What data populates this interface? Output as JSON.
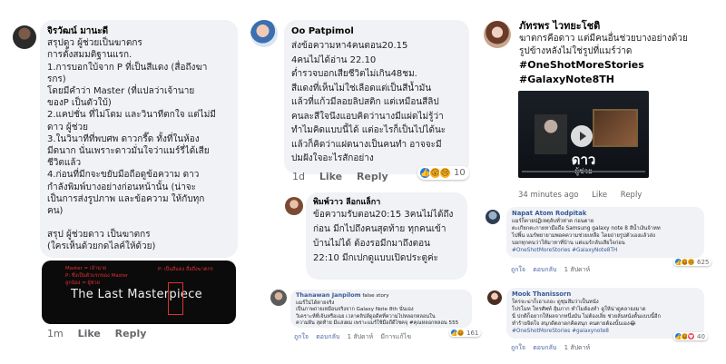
{
  "c1": {
    "name": "จิรวัฒน์ มานะดี",
    "lines": [
      "สรุปดูว ผู้ช่วยเป็นฆาตกร",
      "การตั้งสมมติฐานแรก.",
      "1.การบอกใบ้จาก P ที่เป็นสีแดง (สื่อถึงฆา",
      "รกร)",
      "โดยมีคำว่า Master (ที่แปลว่าเจ้านาย",
      "ของP เป็นตัวใบ้)",
      "2.แคปชั่น ที่ไม่โดม และวินาทีตกใจ แต่ไม่มี",
      "ดาว ผู้ช่วย",
      "3.ในวินาทีที่พบศพ ดาวกรี๊ด ทั้งที่ในห้อง",
      "มีดนาก นั่นเพราะดาวมั่นใจว่าแมร์รี่ได้เสีย",
      "ชีวิตแล้ว",
      "4.ก่อนที่มีกจะขยับมือถือดูข้อความ ดาว",
      "กำลังพิมพ์บางอย่างก่อนหน้านั้น (น่าจะ",
      "เป็นการส่งรูปภาพ และข้อความ ให้กับทุก",
      "คน)",
      "",
      "สรุป ผู้ช่วยดาว เป็นฆาตกร",
      "(ใครเห็นด้วยกดไลค์ให้ด้วย)"
    ],
    "img_small": [
      "Master = เจ้านาย",
      "P: ซึ่งเป็นตัวแรกของ Master",
      "ลูกน้อง = ผู้ช่วย"
    ],
    "img_right": "P: เป็นสีแดง สื่อถึงฆาตกร",
    "img_title_a": "The Last ",
    "img_title_b": "Masterp",
    "img_title_c": "iece",
    "meta": [
      "1m",
      "Like",
      "Reply"
    ]
  },
  "c2": {
    "name": "Oo Patpimol",
    "lines": [
      "ส่งข้อความหา4คนตอน20.15",
      "4คนไม่ได้อ่าน 22.10",
      "ต่ำรวจบอกเสียชีวิตไม่เกิน48ชม.",
      "สีแดงที่เห็นไม่ใช่เลือดแต่เป็นสีน้ำมัน",
      "แล้วที่แก้วมีลอยลิปสติก แต่เหมือนสีลิป",
      "คนละสีใจนึงแอบคิดว่านางมีแผ่ดไม่รู้ว่า",
      "ทำไมคิดแบบนี้ได้ แต่อะไรก็เป็นไปได้นะ",
      "แล้วก็คิดว่าแฝดนางเป็นคนทำ อาจจะมี",
      "ปมฝังใจอะไรสักอย่าง"
    ],
    "meta": [
      "1d",
      "Like",
      "Reply"
    ],
    "reacts": "10"
  },
  "c3": {
    "name": "พิมพ์วาว ลีอกแล็กา",
    "lines": [
      "ข้อความรับตอน20:15 3คนไม่ได้ถึง",
      "ก่อน  มีกไปถึงคนสุดท้าย ทุกคนเข้า",
      "บ้านไม่ได้ ต้องรอมีกมาถึงตอน",
      "22:10 มีกเปกดูแบบเปิดประตูค่ะ"
    ]
  },
  "c4": {
    "name": "Thanawan Janpilom",
    "tag": "false story",
    "lines": [
      "แมร์ใน่ได้ตายจริง",
      "เป็นภาพถ่ายเหมือนจริงจาก Galaxy Note 8th นั่นเอง",
      "วิเคราะห์ที่เจ้นหรือเฉย เวลาคลิปส์ดูอดีตที่ความไปหลอกหลอนใน",
      "ความฝัน สุดท้าย มีเเสงผม เพราะแมร์ใช้มือถึดีไซคจุ #คุณหลอกหลอน 555"
    ],
    "meta": [
      "ถูกใจ",
      "ตอบกลับ",
      "1 สัปดาห์",
      "มีการแก้ไข"
    ],
    "reacts": "161"
  },
  "c5": {
    "name": "ภัทรพร ไวทยะโชติ",
    "lines": [
      "ฆาตกรคือดาว แต่มีคนอื่นช่วยบางอย่างด้วย",
      "รูปข้างหลังไม่ใช่รูปที่แมร์ว่าด"
    ],
    "tags": [
      "#OneShotMoreStories",
      "#GalaxyNote8TH"
    ],
    "video_title": "ดาว",
    "video_sub": "ผู้ช่วย",
    "meta": [
      "34 minutes ago",
      "Like",
      "Reply"
    ]
  },
  "c6": {
    "name": "Napat Atom Rodpitak",
    "lines": [
      "แมร์ก็ตายปฏิเหตุลับทั่วห่าต ก่อนตาย",
      "ตะเกียกตะกายหามือถือ Samsung galaxy note 8 สีน้ำเงินจ้าหท",
      "ไปพิ้น แมร์พยายามพอคความช่วยเหลือ โดยถ่ายรูปตัวเองแล้วส่ง",
      "บอกทุกคนว่าให้มาหาที่บ้าน แต่แมร์กลับเสียใจก่อน"
    ],
    "tags": "#OneShotMoreStories #GalaxyNote8TH",
    "meta": [
      "ถูกใจ",
      "ตอบกลับ",
      "1 สัปดาห์"
    ],
    "reacts": "625"
  },
  "c7": {
    "name": "Mook Thanissorn",
    "lines": [
      "ใครจะฆ่าก็เอาเถอะ ดูชุมสีมว่าเป็นหนัง",
      "โปรโมท โทรศัพท์ สุ้มภาก ทำไมต้องทำ ดูให้น่าดูคลายงมาด",
      "นี่ ปกติก็อยากให้ผลจากหนึ่งมัน ไม่ต้องเลิ่ย ช่วยลันหนังตั้นแบบนี้อีก",
      "ทำร้ายจิตใจ สนุกดีตลาดกคิดสนุก คนตายต้องนั้นเอง😂"
    ],
    "tags": "#OneShotMoreStories #galaxynote8",
    "meta": [
      "ถูกใจ",
      "ตอบกลับ",
      "1 สัปดาห์"
    ],
    "reacts": "40"
  }
}
